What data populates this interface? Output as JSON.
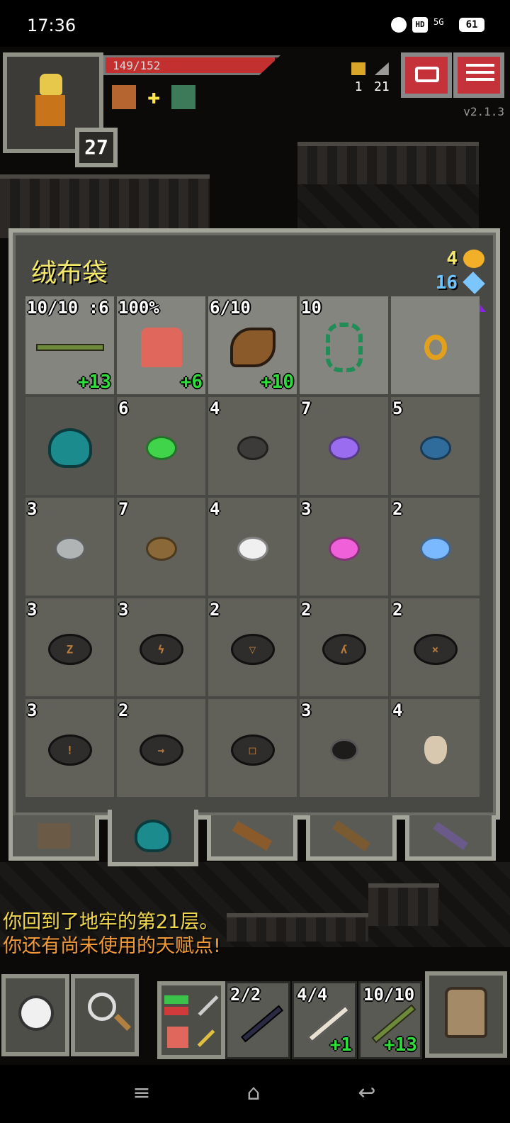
{
  "status_bar": {
    "time": "17:36",
    "battery": "61",
    "network": "5G",
    "hd": "HD"
  },
  "hud": {
    "hp_text": "149/152",
    "hp_fraction": 0.98,
    "hero_level": "27",
    "challenges": "1",
    "depth": "21",
    "version": "v2.1.3",
    "buffs": [
      "buff-orange-icon",
      "buff-star-icon",
      "buff-green-icon"
    ]
  },
  "bag": {
    "title": "绒布袋",
    "gold": "4",
    "gems": "16",
    "equipped": [
      {
        "qty": "10/10 :6",
        "bonus": "+13",
        "icon": "staff-icon"
      },
      {
        "qty": "100%",
        "bonus": "+6",
        "icon": "robe-icon"
      },
      {
        "qty": "6/10",
        "bonus": "+10",
        "icon": "horn-of-plenty-icon"
      },
      {
        "qty": "10",
        "bonus": "",
        "icon": "chain-icon"
      },
      {
        "qty": "",
        "bonus": "",
        "icon": "ring-icon"
      }
    ],
    "row2": [
      {
        "qty": "",
        "icon": "velvet-pouch-icon"
      },
      {
        "qty": "6",
        "icon": "seed-green-icon",
        "color": "#3fd44a"
      },
      {
        "qty": "4",
        "icon": "seed-dark-icon",
        "color": "#3c3b3a"
      },
      {
        "qty": "7",
        "icon": "seed-purple-icon",
        "color": "#9a6cf0"
      },
      {
        "qty": "5",
        "icon": "seed-blue-icon",
        "color": "#2f6c9c"
      }
    ],
    "row3": [
      {
        "qty": "3",
        "icon": "seed-grey-icon",
        "color": "#b0b4b4"
      },
      {
        "qty": "7",
        "icon": "seed-brown-icon",
        "color": "#8a6838"
      },
      {
        "qty": "4",
        "icon": "seed-white-icon",
        "color": "#f0f0f0"
      },
      {
        "qty": "3",
        "icon": "seed-pink-icon",
        "color": "#f060d8"
      },
      {
        "qty": "2",
        "icon": "seed-lightblue-icon",
        "color": "#7ab8ff"
      }
    ],
    "row4": [
      {
        "qty": "3",
        "icon": "runestone-icon"
      },
      {
        "qty": "3",
        "icon": "runestone-icon"
      },
      {
        "qty": "2",
        "icon": "runestone-icon"
      },
      {
        "qty": "2",
        "icon": "runestone-icon"
      },
      {
        "qty": "2",
        "icon": "runestone-icon"
      }
    ],
    "row5": [
      {
        "qty": "3",
        "icon": "runestone-icon"
      },
      {
        "qty": "2",
        "icon": "runestone-icon"
      },
      {
        "qty": "",
        "icon": "runestone-icon"
      },
      {
        "qty": "3",
        "icon": "pebble-icon"
      },
      {
        "qty": "4",
        "icon": "flask-icon"
      }
    ]
  },
  "log": {
    "line1": "你回到了地牢的第21层。",
    "line2": "你还有尚未使用的天赋点!"
  },
  "quickslots": [
    {
      "qty": "2/2",
      "bonus": "",
      "icon": "dark-wand-icon"
    },
    {
      "qty": "4/4",
      "bonus": "+1",
      "icon": "bone-wand-icon"
    },
    {
      "qty": "10/10",
      "bonus": "+13",
      "icon": "staff-icon"
    }
  ]
}
